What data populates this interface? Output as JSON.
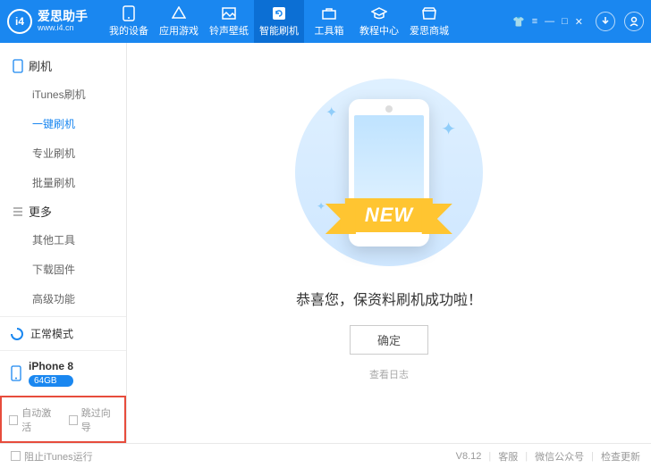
{
  "header": {
    "brand_name": "爱思助手",
    "brand_url": "www.i4.cn",
    "brand_mark": "i4",
    "nav": [
      {
        "label": "我的设备"
      },
      {
        "label": "应用游戏"
      },
      {
        "label": "铃声壁纸"
      },
      {
        "label": "智能刷机"
      },
      {
        "label": "工具箱"
      },
      {
        "label": "教程中心"
      },
      {
        "label": "爱思商城"
      }
    ],
    "nav_active_index": 3
  },
  "sidebar": {
    "sec_flash": {
      "title": "刷机",
      "items": [
        "iTunes刷机",
        "一键刷机",
        "专业刷机",
        "批量刷机"
      ],
      "active_index": 1
    },
    "sec_more": {
      "title": "更多",
      "items": [
        "其他工具",
        "下载固件",
        "高级功能"
      ]
    },
    "mode": {
      "label": "正常模式"
    },
    "device": {
      "name": "iPhone 8",
      "storage": "64GB"
    },
    "options": {
      "auto_activate": "自动激活",
      "skip_guide": "跳过向导"
    }
  },
  "main": {
    "ribbon_text": "NEW",
    "success_msg": "恭喜您，保资料刷机成功啦！",
    "ok_btn": "确定",
    "view_log": "查看日志"
  },
  "footer": {
    "block_itunes": "阻止iTunes运行",
    "version": "V8.12",
    "links": [
      "客服",
      "微信公众号",
      "检查更新"
    ]
  }
}
